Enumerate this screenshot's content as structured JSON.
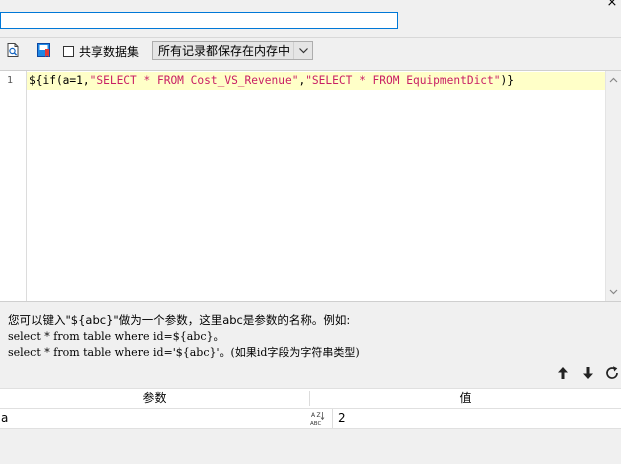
{
  "header": {
    "name_value": "",
    "close_glyph": "×"
  },
  "toolbar": {
    "shared_dataset_label": "共享数据集",
    "storage_select_value": "所有记录都保存在内存中"
  },
  "editor": {
    "line_number": "1",
    "code_tokens": {
      "p1": "${if(a=1,",
      "s1": "\"SELECT * FROM Cost_VS_Revenue\"",
      "p2": ",",
      "s2": "\"SELECT * FROM EquipmentDict\"",
      "p3": ")}"
    }
  },
  "hint": {
    "line1": "您可以键入\"${abc}\"做为一个参数，这里abc是参数的名称。例如:",
    "line2": "select * from table where id=${abc}。",
    "line3": "select * from table where id='${abc}'。(如果id字段为字符串类型)"
  },
  "params": {
    "col_param": "参数",
    "col_value": "值",
    "rows": [
      {
        "param": "a",
        "value": "2"
      }
    ]
  },
  "colors": {
    "accent": "#0078d7",
    "string": "#c81e64",
    "current_line": "#ffffc8"
  },
  "icons": {
    "preview": "preview-icon",
    "bookmark": "bookmark-icon",
    "move_up": "arrow-up-icon",
    "move_down": "arrow-down-icon",
    "refresh": "refresh-icon",
    "type": "abc-type-icon"
  }
}
